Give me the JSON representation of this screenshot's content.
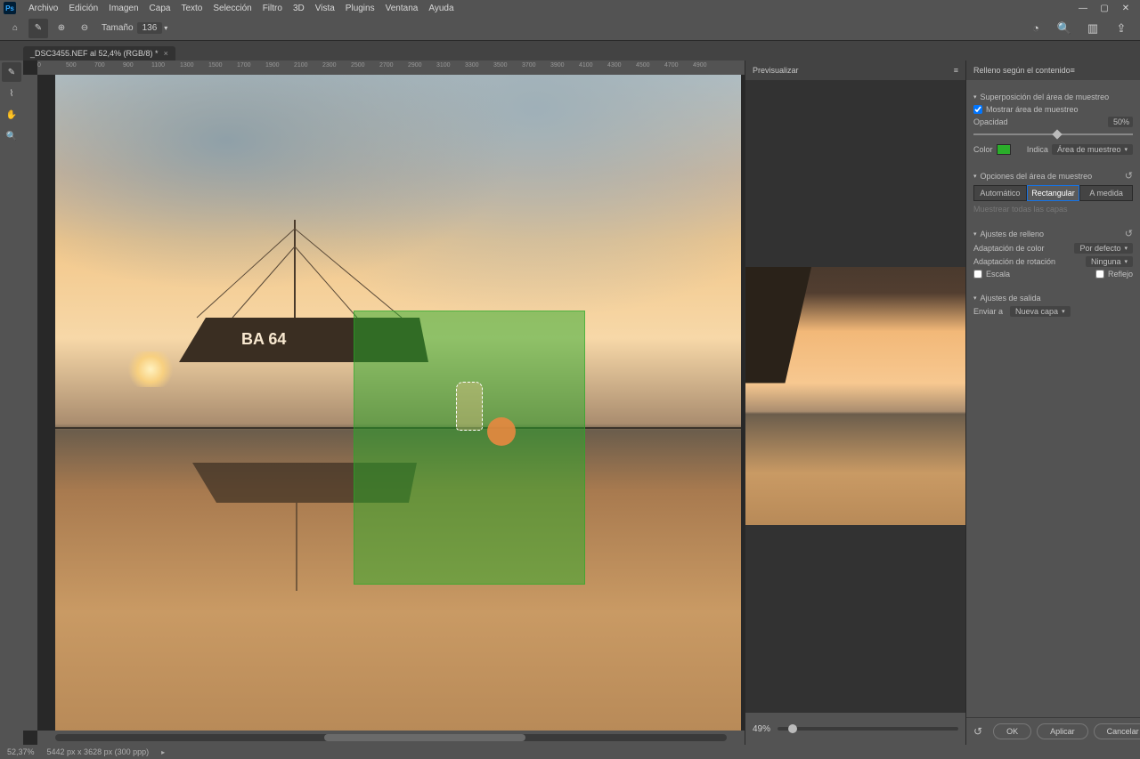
{
  "menu": [
    "Archivo",
    "Edición",
    "Imagen",
    "Capa",
    "Texto",
    "Selección",
    "Filtro",
    "3D",
    "Vista",
    "Plugins",
    "Ventana",
    "Ayuda"
  ],
  "options": {
    "size_label": "Tamaño",
    "size_value": "136"
  },
  "tab": {
    "title": "_DSC3455.NEF al 52,4% (RGB/8) *"
  },
  "ruler_ticks": [
    "0",
    "500",
    "700",
    "900",
    "1100",
    "1300",
    "1500",
    "1700",
    "1900",
    "2100",
    "2300",
    "2500",
    "2700",
    "2900",
    "3100",
    "3300",
    "3500",
    "3700",
    "3900",
    "4100",
    "4300",
    "4500",
    "4700",
    "4900"
  ],
  "preview": {
    "title": "Previsualizar",
    "zoom": "49%"
  },
  "panel": {
    "title": "Relleno según el contenido",
    "overlay": {
      "title": "Superposición del área de muestreo",
      "show": "Mostrar área de muestreo",
      "opacity_label": "Opacidad",
      "opacity_value": "50%",
      "color_label": "Color",
      "color_hex": "#2aae2a",
      "indicates_label": "Indica",
      "indicates_value": "Área de muestreo"
    },
    "sampling": {
      "title": "Opciones del área de muestreo",
      "auto": "Automático",
      "rect": "Rectangular",
      "custom": "A medida",
      "sample_all": "Muestrear todas las capas"
    },
    "fill": {
      "title": "Ajustes de relleno",
      "color_adapt_label": "Adaptación de color",
      "color_adapt_value": "Por defecto",
      "rotation_label": "Adaptación de rotación",
      "rotation_value": "Ninguna",
      "scale": "Escala",
      "mirror": "Reflejo"
    },
    "output": {
      "title": "Ajustes de salida",
      "send_to_label": "Enviar a",
      "send_to_value": "Nueva capa"
    },
    "buttons": {
      "ok": "OK",
      "apply": "Aplicar",
      "cancel": "Cancelar"
    }
  },
  "status": {
    "zoom": "52,37%",
    "dims": "5442 px x 3628 px (300 ppp)"
  }
}
